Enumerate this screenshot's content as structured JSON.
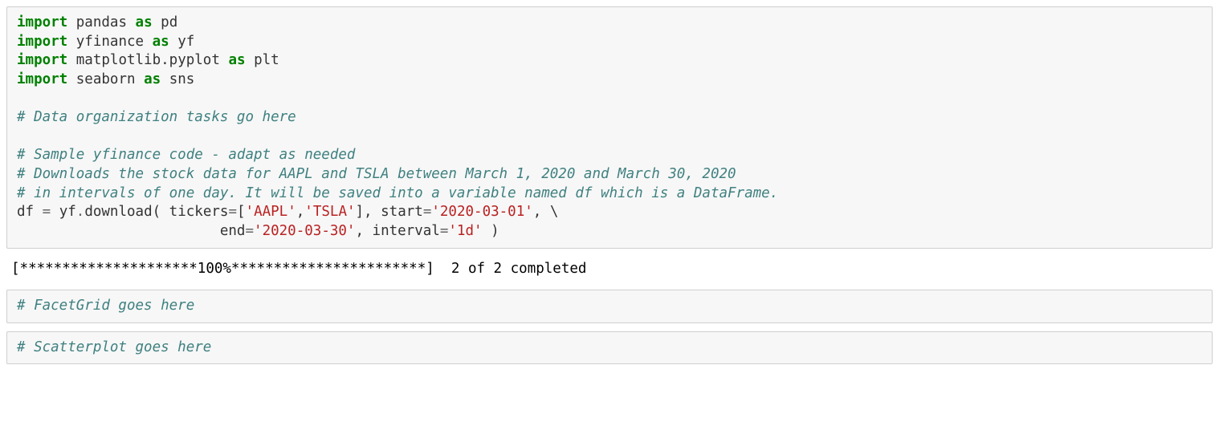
{
  "cells": {
    "code1": {
      "line1": {
        "kw_import": "import",
        "mod": "pandas",
        "kw_as": "as",
        "alias": "pd"
      },
      "line2": {
        "kw_import": "import",
        "mod": "yfinance",
        "kw_as": "as",
        "alias": "yf"
      },
      "line3": {
        "kw_import": "import",
        "mod": "matplotlib.pyplot",
        "kw_as": "as",
        "alias": "plt"
      },
      "line4": {
        "kw_import": "import",
        "mod": "seaborn",
        "kw_as": "as",
        "alias": "sns"
      },
      "comment1": "# Data organization tasks go here",
      "comment2": "# Sample yfinance code - adapt as needed",
      "comment3": "# Downloads the stock data for AAPL and TSLA between March 1, 2020 and March 30, 2020",
      "comment4": "# in intervals of one day. It will be saved into a variable named df which is a DataFrame.",
      "dl_line_a": {
        "lhs": "df ",
        "eq": "=",
        "pre": " yf",
        "dot": ".",
        "fn": "download( tickers",
        "eq2": "=",
        "brk_open": "[",
        "str1": "'AAPL'",
        "comma1": ",",
        "str2": "'TSLA'",
        "brk_close": "], start",
        "eq3": "=",
        "str3": "'2020-03-01'",
        "comma2": ", ",
        "bslash": "\\"
      },
      "dl_line_b": {
        "indent": "                        end",
        "eq": "=",
        "str1": "'2020-03-30'",
        "mid": ", interval",
        "eq2": "=",
        "str2": "'1d'",
        "tail": " )"
      }
    },
    "output1": "[*********************100%***********************]  2 of 2 completed",
    "code2": {
      "comment": "# FacetGrid goes here"
    },
    "code3": {
      "comment": "# Scatterplot goes here"
    }
  }
}
